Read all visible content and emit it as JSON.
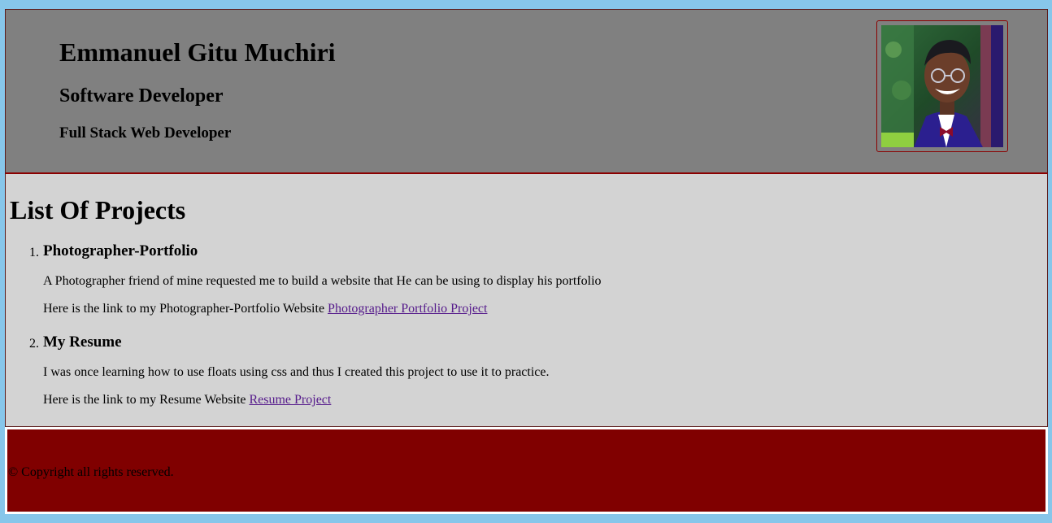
{
  "header": {
    "name": "Emmanuel Gitu Muchiri",
    "title": "Software Developer",
    "subtitle": "Full Stack Web Developer",
    "photo": "profile-photo"
  },
  "main": {
    "heading": "List Of Projects",
    "projects": [
      {
        "number": "1.",
        "title": "Photographer-Portfolio",
        "description": "A Photographer friend of mine requested me to build a website that He can be using to display his portfolio",
        "link_prefix": "Here is the link to my Photographer-Portfolio Website ",
        "link_text": "Photographer Portfolio Project"
      },
      {
        "number": "2.",
        "title": "My Resume",
        "description": "I was once learning how to use floats using css and thus I created this project to use it to practice.",
        "link_prefix": "Here is the link to my Resume Website ",
        "link_text": "Resume Project"
      }
    ]
  },
  "footer": {
    "copyright": "© Copyright all rights reserved."
  },
  "colors": {
    "page_background": "#87c6ea",
    "header_background": "#808080",
    "main_background": "#d3d3d3",
    "footer_background": "#800000",
    "accent_border": "#8b0000",
    "link": "#551a8b"
  }
}
